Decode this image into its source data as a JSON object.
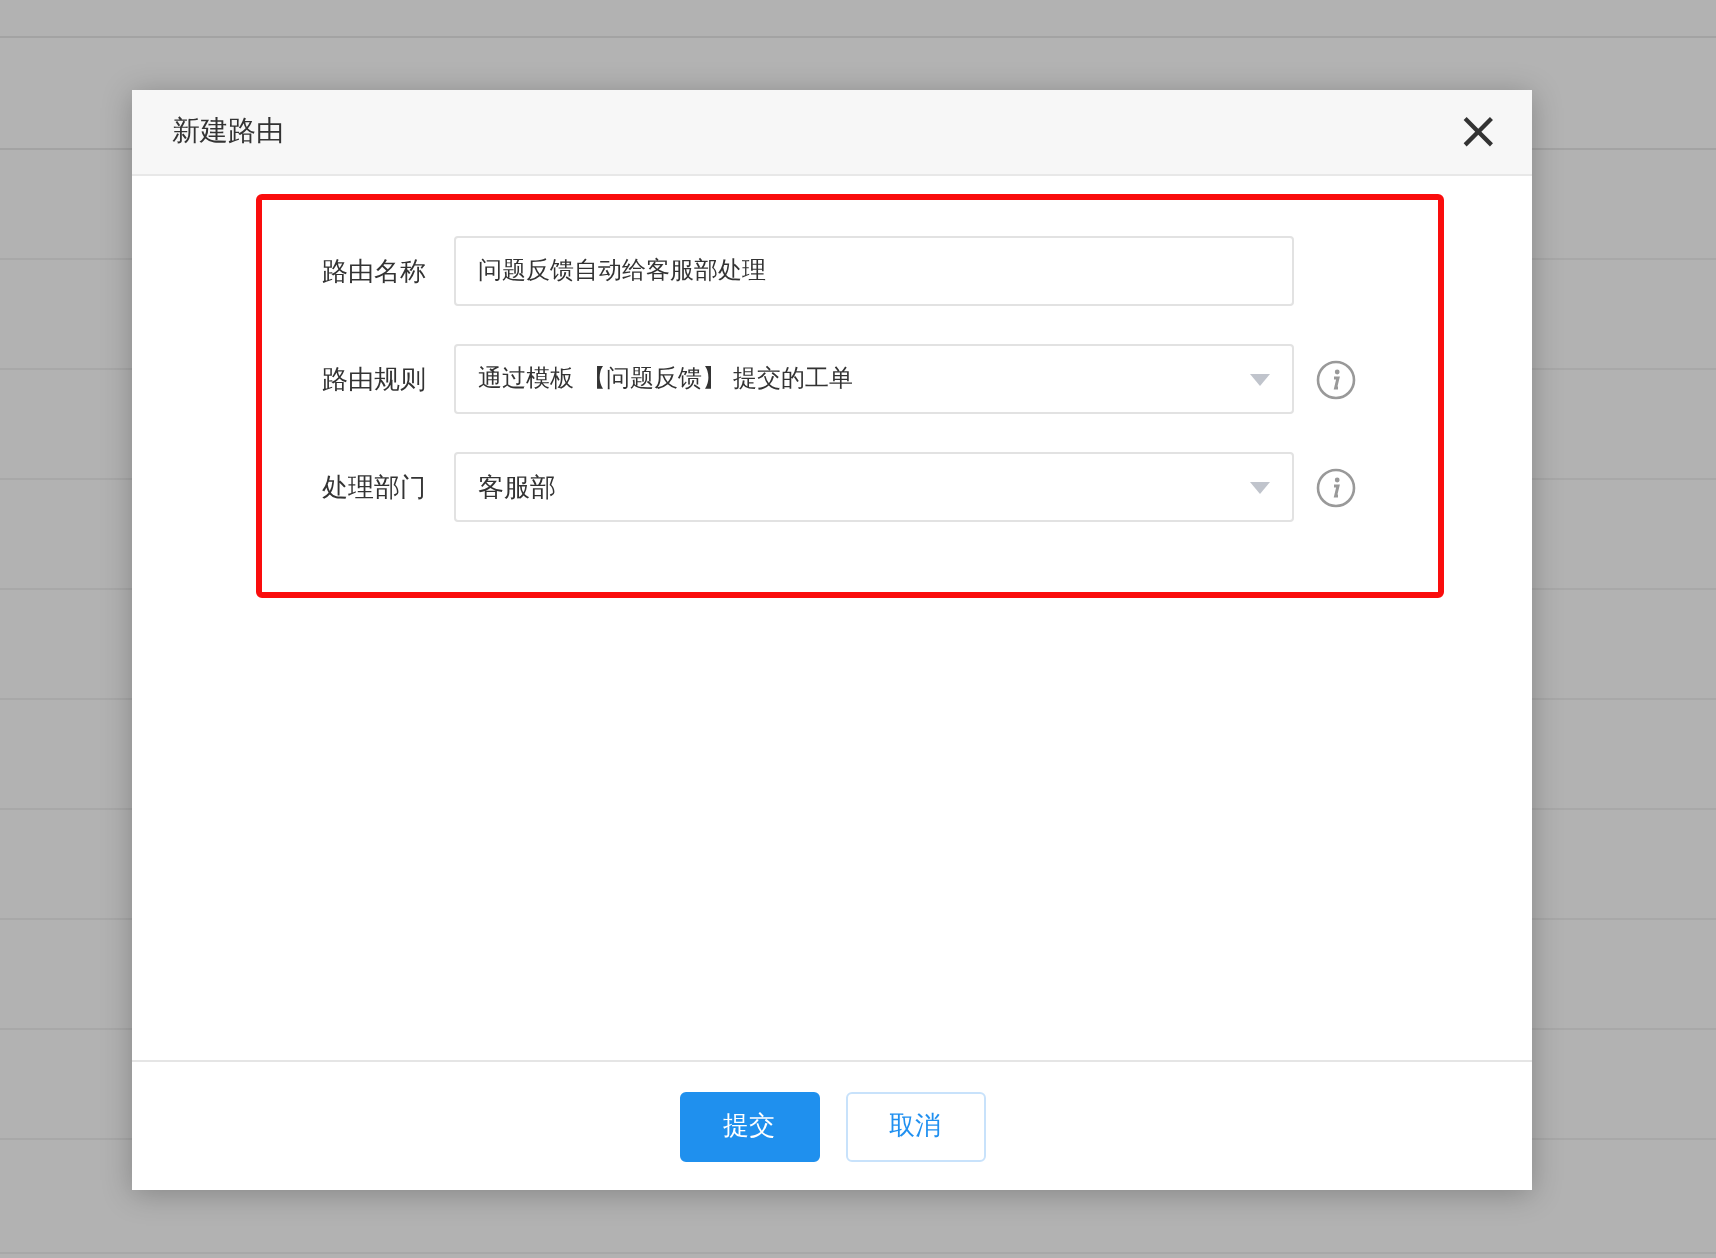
{
  "dialog": {
    "title": "新建路由",
    "close": "×",
    "fields": [
      {
        "kind": "input",
        "label": "路由名称",
        "value": "问题反馈自动给客服部处理",
        "info": false
      },
      {
        "kind": "select",
        "label": "路由规则",
        "value": "通过模板 【问题反馈】 提交的工单",
        "info": true
      },
      {
        "kind": "select",
        "label": "处理部门",
        "value": "客服部",
        "info": true
      }
    ],
    "highlight": true,
    "buttons": [
      {
        "label": "提交",
        "primary": true
      },
      {
        "label": "取消",
        "primary": false
      }
    ]
  }
}
